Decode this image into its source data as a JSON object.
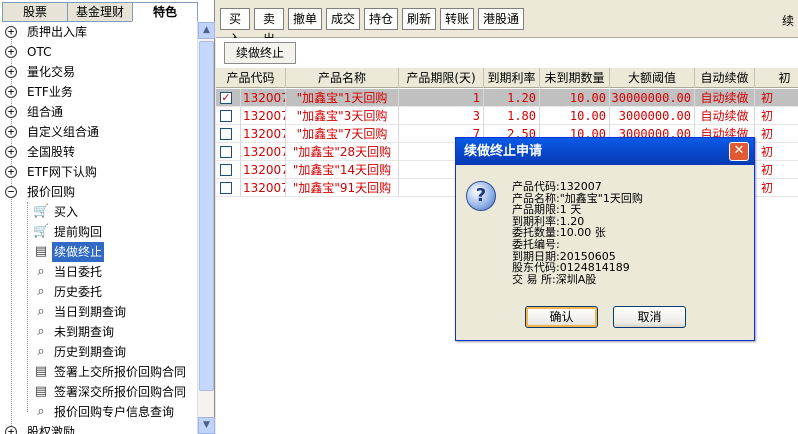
{
  "left_tabs": [
    "股票",
    "基金理财",
    "特色"
  ],
  "tree": {
    "top_items": [
      {
        "label": "质押出入库",
        "exp": "+"
      },
      {
        "label": "OTC",
        "exp": "+"
      },
      {
        "label": "量化交易",
        "exp": "+"
      },
      {
        "label": "ETF业务",
        "exp": "+"
      },
      {
        "label": "组合通",
        "exp": "+"
      },
      {
        "label": "自定义组合通",
        "exp": "+"
      },
      {
        "label": "全国股转",
        "exp": "+"
      },
      {
        "label": "ETF网下认购",
        "exp": "+"
      },
      {
        "label": "报价回购",
        "exp": "−"
      }
    ],
    "children": [
      {
        "label": "买入",
        "icon": "cart-icon"
      },
      {
        "label": "提前购回",
        "icon": "cart-icon"
      },
      {
        "label": "续做终止",
        "icon": "document-icon",
        "selected": true
      },
      {
        "label": "当日委托",
        "icon": "magnifier-icon"
      },
      {
        "label": "历史委托",
        "icon": "magnifier-icon"
      },
      {
        "label": "当日到期查询",
        "icon": "magnifier-icon"
      },
      {
        "label": "未到期查询",
        "icon": "magnifier-icon"
      },
      {
        "label": "历史到期查询",
        "icon": "magnifier-icon"
      },
      {
        "label": "签署上交所报价回购合同",
        "icon": "document-icon"
      },
      {
        "label": "签署深交所报价回购合同",
        "icon": "document-icon"
      },
      {
        "label": "报价回购专户信息查询",
        "icon": "magnifier-icon"
      }
    ],
    "last_item": {
      "label": "股权激励",
      "exp": "+"
    }
  },
  "toolbar": {
    "buttons": [
      "买入",
      "卖出",
      "撤单",
      "成交",
      "持仓",
      "刷新",
      "转账",
      "港股通"
    ],
    "right_text": "续"
  },
  "action_button": "续做终止",
  "table": {
    "headers": [
      "产品代码",
      "产品名称",
      "产品期限(天)",
      "到期利率",
      "未到期数量",
      "大额阈值",
      "自动续做",
      "初"
    ],
    "rows": [
      {
        "checked": true,
        "code": "132007",
        "name": "\"加鑫宝\"1天回购",
        "term": "1",
        "rate": "1.20",
        "qty": "10.00",
        "threshold": "30000000.00",
        "auto": "自动续做",
        "extra": "初"
      },
      {
        "checked": false,
        "code": "132007",
        "name": "\"加鑫宝\"3天回购",
        "term": "3",
        "rate": "1.80",
        "qty": "10.00",
        "threshold": "3000000.00",
        "auto": "自动续做",
        "extra": "初"
      },
      {
        "checked": false,
        "code": "132007",
        "name": "\"加鑫宝\"7天回购",
        "term": "7",
        "rate": "2.50",
        "qty": "10.00",
        "threshold": "3000000.00",
        "auto": "自动续做",
        "extra": "初"
      },
      {
        "checked": false,
        "code": "132007",
        "name": "\"加鑫宝\"28天回购",
        "term": "",
        "rate": "",
        "qty": "",
        "threshold": "",
        "auto": "",
        "extra": "初"
      },
      {
        "checked": false,
        "code": "132007",
        "name": "\"加鑫宝\"14天回购",
        "term": "",
        "rate": "",
        "qty": "",
        "threshold": "",
        "auto": "",
        "extra": "初"
      },
      {
        "checked": false,
        "code": "132007",
        "name": "\"加鑫宝\"91天回购",
        "term": "",
        "rate": "",
        "qty": "",
        "threshold": "",
        "auto": "",
        "extra": "初"
      }
    ]
  },
  "dialog": {
    "title": "续做终止申请",
    "close_glyph": "✕",
    "question_glyph": "?",
    "lines": [
      "产品代码:132007",
      "产品名称:\"加鑫宝\"1天回购",
      "产品期限:1 天",
      "到期利率:1.20",
      "委托数量:10.00 张",
      "委托编号:",
      "到期日期:20150605",
      "股东代码:0124814189",
      "交 易 所:深圳A股"
    ],
    "ok": "确认",
    "cancel": "取消"
  },
  "colors": {
    "row_text": "#d40000",
    "selection": "#316ac5",
    "title_bar": "#0845c8"
  }
}
